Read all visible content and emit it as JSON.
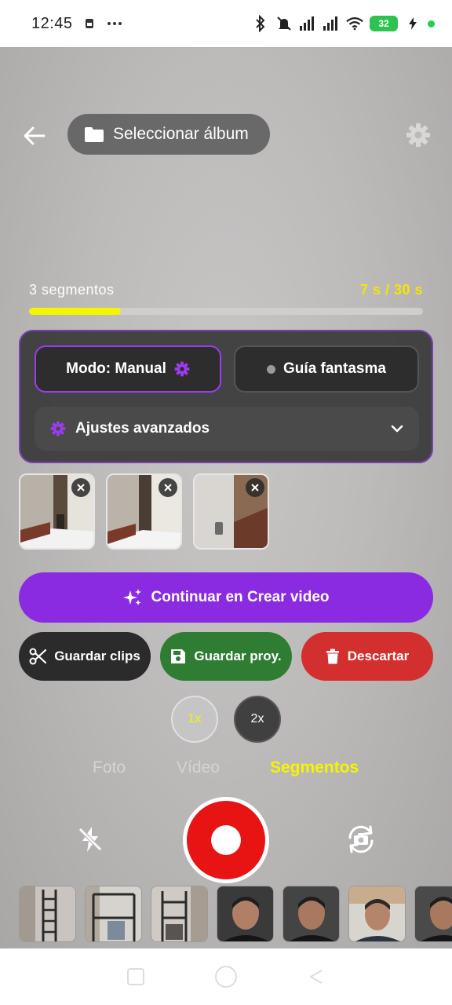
{
  "status": {
    "time": "12:45",
    "battery": "32",
    "icons": [
      "sim-card-icon",
      "more-dots-icon",
      "bluetooth-icon",
      "mute-icon",
      "signal-icon",
      "signal-icon",
      "wifi-icon",
      "battery-icon",
      "charging-icon"
    ]
  },
  "header": {
    "album_label": "Seleccionar álbum",
    "back_icon": "arrow-left-icon",
    "settings_icon": "gear-icon"
  },
  "segments": {
    "count_label": "3 segmentos",
    "time_label": "7 s / 30 s",
    "progress": 0.233
  },
  "mode_panel": {
    "manual_label": "Modo: Manual",
    "ghost_label": "Guía fantasma",
    "advanced_label": "Ajustes avanzados"
  },
  "clips": [
    {
      "name": "clip-1"
    },
    {
      "name": "clip-2"
    },
    {
      "name": "clip-3"
    }
  ],
  "continue_label": "Continuar en Crear video",
  "actions": {
    "save_clips": "Guardar clips",
    "save_project": "Guardar proy.",
    "discard": "Descartar"
  },
  "zoom": {
    "option_1": "1x",
    "option_2": "2x",
    "selected": "1x"
  },
  "capture_modes": {
    "photo": "Foto",
    "video": "Vídeo",
    "segments": "Segmentos",
    "selected": "Segmentos"
  },
  "colors": {
    "accent_purple": "#8a2be2",
    "highlight_yellow": "#f5f500",
    "record_red": "#e81313",
    "save_green": "#2e7d32",
    "discard_red": "#d32f2f"
  }
}
